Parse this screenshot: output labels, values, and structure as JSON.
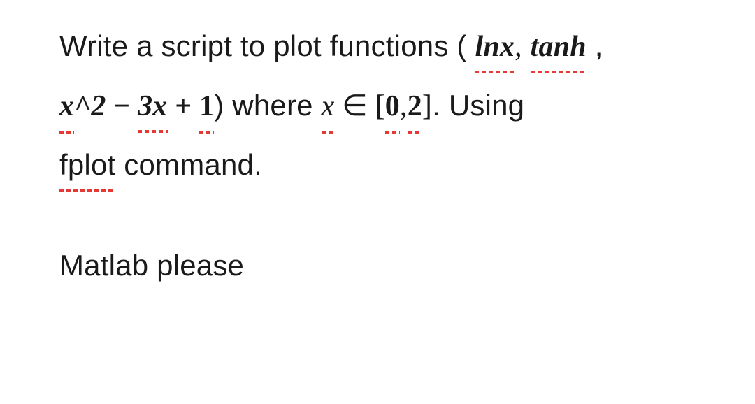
{
  "text": {
    "write_script": "Write a script to plot functions (",
    "lnx": "lnx",
    "comma1": ",",
    "tanh": "tanh",
    "comma2": " ,",
    "x_sq": "x",
    "caret2": "^2",
    "minus": " − ",
    "three_x": "3x",
    "plus": " + ",
    "one": "1",
    "where": ") where ",
    "x_var": "x",
    "element": " ∈ ",
    "bracket_open": "[",
    "zero": "0",
    "comma3": ",",
    "two": " 2",
    "bracket_close": "]",
    "using": ". Using",
    "fplot": "fplot",
    "command": " command.",
    "matlab": "Matlab please"
  }
}
